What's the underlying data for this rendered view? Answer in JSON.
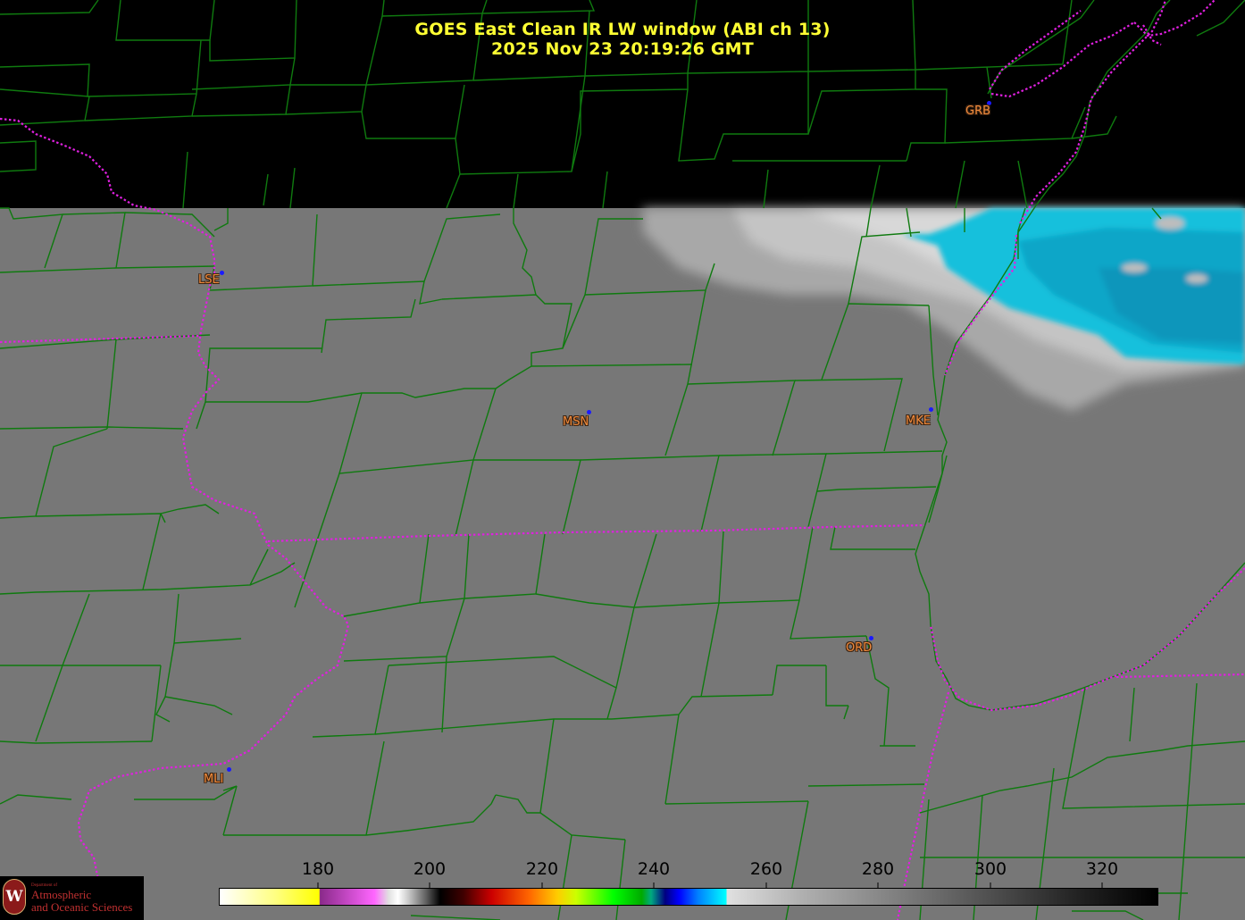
{
  "title": {
    "line1": "GOES East Clean IR LW window (ABI ch 13)",
    "line2": "2025 Nov 23  20:19:26 GMT"
  },
  "stations": [
    {
      "id": "GRB",
      "label": "GRB"
    },
    {
      "id": "LSE",
      "label": "LSE"
    },
    {
      "id": "MSN",
      "label": "MSN"
    },
    {
      "id": "MKE",
      "label": "MKE"
    },
    {
      "id": "ORD",
      "label": "ORD"
    },
    {
      "id": "MLI",
      "label": "MLI"
    }
  ],
  "colorbar": {
    "ticks": [
      "180",
      "200",
      "220",
      "240",
      "260",
      "280",
      "300",
      "320"
    ],
    "min": 173,
    "max": 340
  },
  "logo": {
    "line1": "Department of",
    "line2": "Atmospheric",
    "line3": "and Oceanic Sciences",
    "seal_letter": "W"
  },
  "colors": {
    "title": "#ffff33",
    "county_lines": "#0f7a0f",
    "state_lines": "#e020e0",
    "station_label": "#f08a3c",
    "station_dot": "#1a1aff",
    "cold_cloud": "#00c8e0",
    "ground": "#777777",
    "no_data": "#000000"
  },
  "icons": {
    "logo": "uw-seal-icon",
    "station_marker": "dot-marker-icon"
  }
}
